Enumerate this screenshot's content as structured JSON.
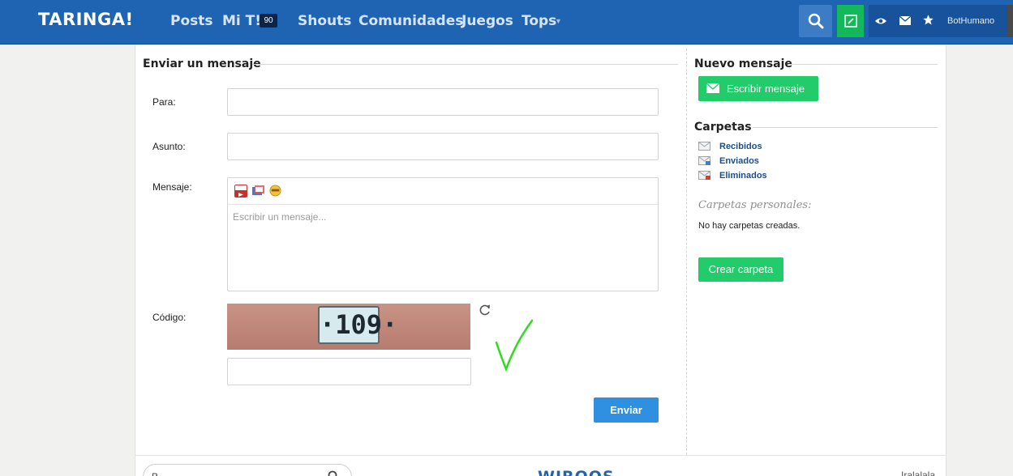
{
  "navbar": {
    "logo": "TARINGA!",
    "items": [
      "Posts",
      "Mi T!",
      "Shouts",
      "Comunidades",
      "Juegos",
      "Tops"
    ],
    "mi_badge": "90",
    "username": "BotHumano"
  },
  "form": {
    "title": "Enviar un mensaje",
    "to_label": "Para:",
    "subject_label": "Asunto:",
    "message_label": "Mensaje:",
    "message_placeholder": "Escribir un mensaje...",
    "code_label": "Código:",
    "captcha_text": "·109·",
    "submit_label": "Enviar"
  },
  "sidebar": {
    "new_title": "Nuevo mensaje",
    "write_button": "Escribir mensaje",
    "folders_title": "Carpetas",
    "folders": [
      "Recibidos",
      "Enviados",
      "Eliminados"
    ],
    "personal_title": "Carpetas personales:",
    "empty_text": "No hay carpetas creadas.",
    "create_button": "Crear carpeta"
  },
  "footer": {
    "search_placeholder": "B",
    "logo": "WIROOS",
    "right_link": "Iralalala"
  },
  "colors": {
    "navbar": "#1f64b2",
    "green": "#22cc6a",
    "blue_button": "#2f8fe0",
    "link": "#1a4e8a"
  }
}
